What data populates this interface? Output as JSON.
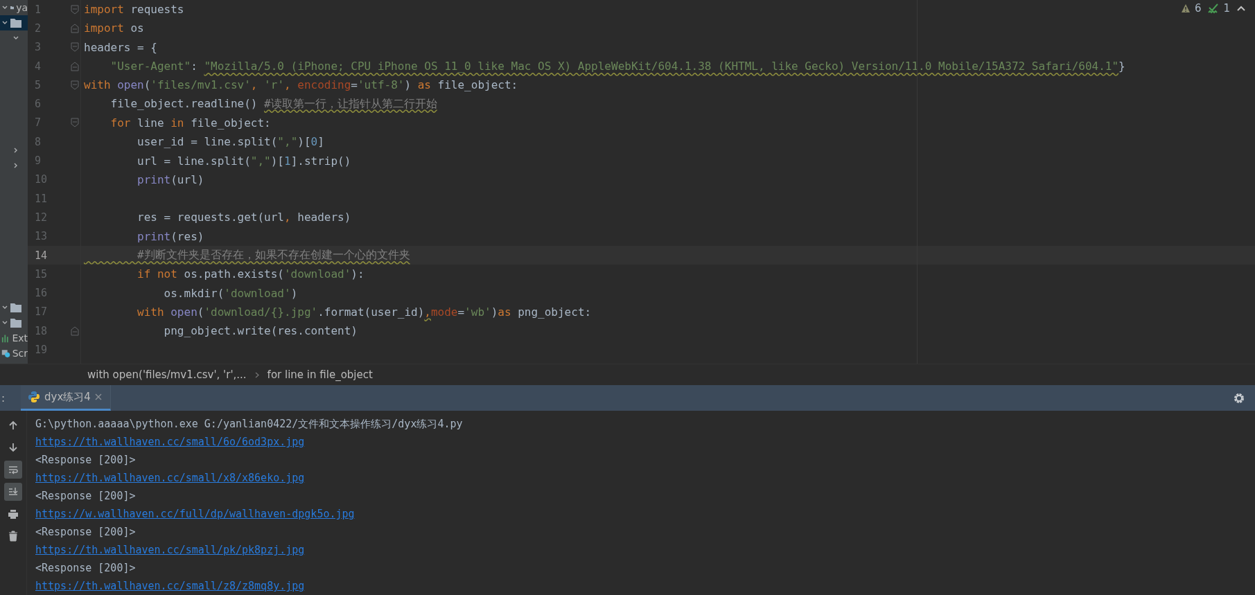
{
  "project_panel": {
    "top_items": [
      {
        "kind": "folder",
        "label": "ya",
        "selected": false
      },
      {
        "kind": "folder",
        "selected": true
      }
    ],
    "mid_items": [
      {
        "kind": "chevron-down"
      },
      {
        "kind": "chevron-right"
      },
      {
        "kind": "chevron-right"
      }
    ],
    "bottom_items": [
      {
        "kind": "folder"
      },
      {
        "kind": "folder"
      },
      {
        "kind": "chart",
        "label": "Ext"
      },
      {
        "kind": "scratch",
        "label": "Scr"
      }
    ]
  },
  "inspections": {
    "warnings": "6",
    "typos": "1"
  },
  "editor": {
    "lines": [
      {
        "number": "1",
        "current": false,
        "kind": "foldstart",
        "tokens": [
          {
            "text": "import",
            "kind": "kw"
          },
          {
            "text": " requests",
            "kind": "plain"
          }
        ]
      },
      {
        "number": "2",
        "current": false,
        "kind": "foldend",
        "tokens": [
          {
            "text": "import",
            "kind": "kw"
          },
          {
            "text": " os",
            "kind": "plain"
          }
        ]
      },
      {
        "number": "3",
        "current": false,
        "kind": "foldstart",
        "tokens": [
          {
            "text": "headers = {",
            "kind": "plain"
          }
        ]
      },
      {
        "number": "4",
        "current": false,
        "kind": "foldend",
        "tokens": [
          {
            "text": "    \"User-Agent\"",
            "kind": "str"
          },
          {
            "text": ": ",
            "kind": "plain"
          },
          {
            "text": "\"Mozilla/5.0 (iPhone; CPU iPhone OS 11_0 like Mac OS X) AppleWebKit/604.1.38 (KHTML, like Gecko) Version/11.0 Mobile/15A372 Safari/604.1\"",
            "kind": "str",
            "wavy": true
          },
          {
            "text": "}",
            "kind": "plain"
          }
        ]
      },
      {
        "number": "5",
        "current": false,
        "kind": "foldstart",
        "tokens": [
          {
            "text": "with ",
            "kind": "kw"
          },
          {
            "text": "open",
            "kind": "builtin"
          },
          {
            "text": "(",
            "kind": "plain"
          },
          {
            "text": "'files/mv1.csv'",
            "kind": "str"
          },
          {
            "text": ", ",
            "kind": "kw"
          },
          {
            "text": "'r'",
            "kind": "str"
          },
          {
            "text": ", ",
            "kind": "kw"
          },
          {
            "text": "encoding",
            "kind": "param"
          },
          {
            "text": "=",
            "kind": "plain"
          },
          {
            "text": "'utf-8'",
            "kind": "str"
          },
          {
            "text": ") ",
            "kind": "plain"
          },
          {
            "text": "as",
            "kind": "kw"
          },
          {
            "text": " file_object:",
            "kind": "plain"
          }
        ]
      },
      {
        "number": "6",
        "current": false,
        "kind": "code",
        "tokens": [
          {
            "text": "    file_object.readline() ",
            "kind": "plain"
          },
          {
            "text": "#读取第一行，让指针从第二行开始",
            "kind": "comment",
            "wavy": true
          }
        ]
      },
      {
        "number": "7",
        "current": false,
        "kind": "foldstart",
        "tokens": [
          {
            "text": "    for",
            "kind": "kw"
          },
          {
            "text": " line ",
            "kind": "plain"
          },
          {
            "text": "in",
            "kind": "kw"
          },
          {
            "text": " file_object:",
            "kind": "plain"
          }
        ]
      },
      {
        "number": "8",
        "current": false,
        "kind": "code",
        "tokens": [
          {
            "text": "        user_id = line.split(",
            "kind": "plain"
          },
          {
            "text": "\",\"",
            "kind": "str"
          },
          {
            "text": ")[",
            "kind": "plain"
          },
          {
            "text": "0",
            "kind": "num"
          },
          {
            "text": "]",
            "kind": "plain"
          }
        ]
      },
      {
        "number": "9",
        "current": false,
        "kind": "code",
        "tokens": [
          {
            "text": "        url = line.split(",
            "kind": "plain"
          },
          {
            "text": "\",\"",
            "kind": "str"
          },
          {
            "text": ")[",
            "kind": "plain"
          },
          {
            "text": "1",
            "kind": "num"
          },
          {
            "text": "].strip()",
            "kind": "plain"
          }
        ]
      },
      {
        "number": "10",
        "current": false,
        "kind": "code",
        "tokens": [
          {
            "text": "        print",
            "kind": "builtin"
          },
          {
            "text": "(url)",
            "kind": "plain"
          }
        ]
      },
      {
        "number": "11",
        "current": false,
        "kind": "code"
      },
      {
        "number": "12",
        "current": false,
        "kind": "code",
        "tokens": [
          {
            "text": "        res = requests.get(url",
            "kind": "plain"
          },
          {
            "text": ", ",
            "kind": "kw"
          },
          {
            "text": "headers)",
            "kind": "plain"
          }
        ]
      },
      {
        "number": "13",
        "current": false,
        "kind": "code",
        "tokens": [
          {
            "text": "        print",
            "kind": "builtin"
          },
          {
            "text": "(res)",
            "kind": "plain"
          }
        ]
      },
      {
        "number": "14",
        "current": true,
        "kind": "code",
        "tokens": [
          {
            "text": "        #判断文件夹是否存在，如果不存在创建一个心的文件夹",
            "kind": "comment",
            "wavy": true
          }
        ]
      },
      {
        "number": "15",
        "current": false,
        "kind": "code",
        "tokens": [
          {
            "text": "        if not",
            "kind": "kw"
          },
          {
            "text": " os.path.exists(",
            "kind": "plain"
          },
          {
            "text": "'download'",
            "kind": "str"
          },
          {
            "text": "):",
            "kind": "plain"
          }
        ]
      },
      {
        "number": "16",
        "current": false,
        "kind": "code",
        "tokens": [
          {
            "text": "            os.mkdir(",
            "kind": "plain"
          },
          {
            "text": "'download'",
            "kind": "str"
          },
          {
            "text": ")",
            "kind": "plain"
          }
        ]
      },
      {
        "number": "17",
        "current": false,
        "kind": "code",
        "tokens": [
          {
            "text": "        with ",
            "kind": "kw"
          },
          {
            "text": "open",
            "kind": "builtin"
          },
          {
            "text": "(",
            "kind": "plain"
          },
          {
            "text": "'download/{}.jpg'",
            "kind": "str"
          },
          {
            "text": ".format(user_id)",
            "kind": "plain"
          },
          {
            "text": ",",
            "kind": "kw",
            "wavy": true
          },
          {
            "text": "mode",
            "kind": "param"
          },
          {
            "text": "=",
            "kind": "plain"
          },
          {
            "text": "'wb'",
            "kind": "str"
          },
          {
            "text": ")",
            "kind": "plain"
          },
          {
            "text": "as",
            "kind": "kw"
          },
          {
            "text": " png_object:",
            "kind": "plain"
          }
        ]
      },
      {
        "number": "18",
        "current": false,
        "kind": "foldend",
        "tokens": [
          {
            "text": "            png_object.write(res.content)",
            "kind": "plain"
          }
        ]
      },
      {
        "number": "19",
        "current": false,
        "kind": "code"
      }
    ]
  },
  "breadcrumbs": [
    "with open('files/mv1.csv', 'r',...",
    "for line in file_object"
  ],
  "run_panel": {
    "prefix": ":",
    "tabs": [
      {
        "label": "dyx练习4",
        "selected": true,
        "closable": true
      }
    ],
    "toolbar": [
      {
        "kind": "up",
        "on": false
      },
      {
        "kind": "down",
        "on": false
      },
      {
        "kind": "wrap",
        "on": true
      },
      {
        "kind": "scroll-end",
        "on": true
      },
      {
        "kind": "print",
        "on": false
      },
      {
        "kind": "trash",
        "on": false
      }
    ],
    "console": [
      {
        "kind": "text",
        "text": "G:\\python.aaaaa\\python.exe G:/yanlian0422/文件和文本操作练习/dyx练习4.py"
      },
      {
        "kind": "link",
        "text": "https://th.wallhaven.cc/small/6o/6od3px.jpg"
      },
      {
        "kind": "text",
        "text": "<Response [200]>"
      },
      {
        "kind": "link",
        "text": "https://th.wallhaven.cc/small/x8/x86eko.jpg"
      },
      {
        "kind": "text",
        "text": "<Response [200]>"
      },
      {
        "kind": "link",
        "text": "https://w.wallhaven.cc/full/dp/wallhaven-dpgk5o.jpg"
      },
      {
        "kind": "text",
        "text": "<Response [200]>"
      },
      {
        "kind": "link",
        "text": "https://th.wallhaven.cc/small/pk/pk8pzj.jpg"
      },
      {
        "kind": "text",
        "text": "<Response [200]>"
      },
      {
        "kind": "link",
        "text": "https://th.wallhaven.cc/small/z8/z8mq8y.jpg"
      }
    ]
  }
}
